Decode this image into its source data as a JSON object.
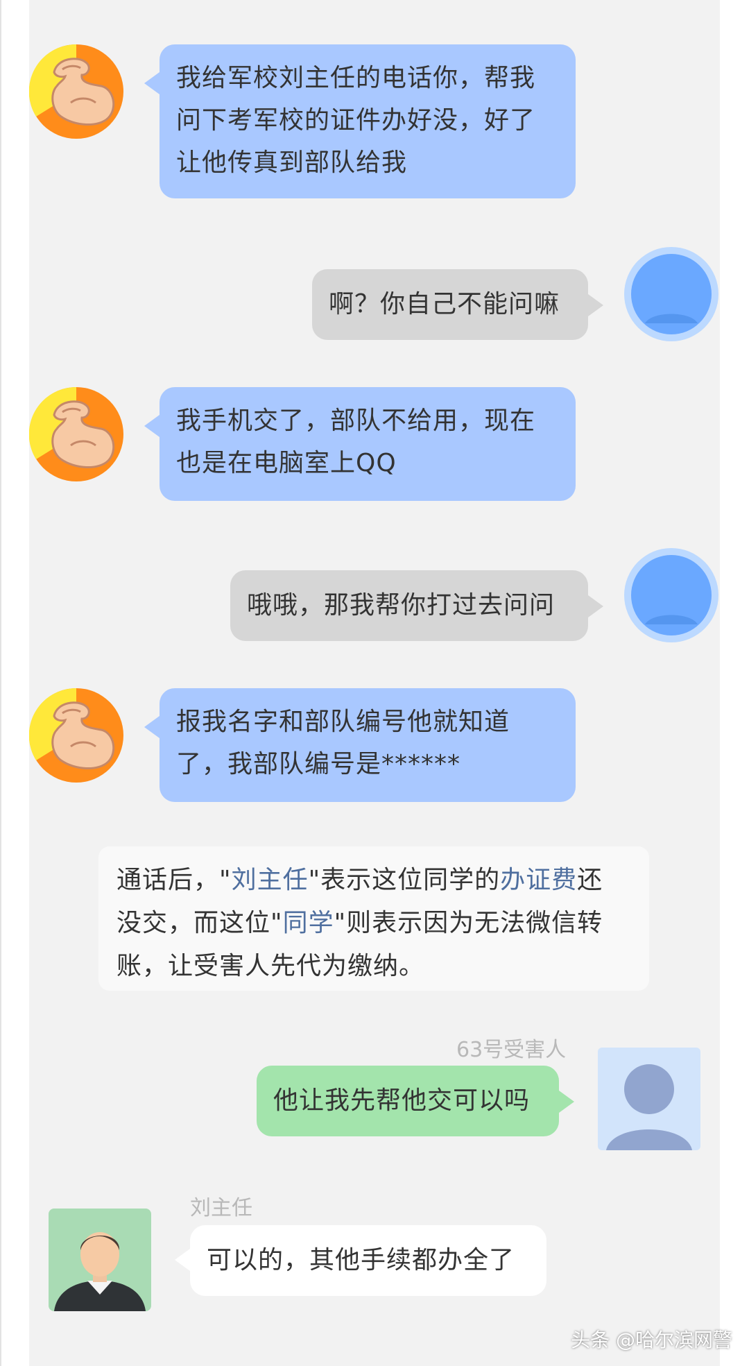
{
  "messages": {
    "m1": {
      "line1": "我给军校刘主任的电话你，帮我",
      "line2": "问下考军校的证件办好没，好了",
      "line3": "让他传真到部队给我"
    },
    "m2": {
      "text": "啊？你自己不能问嘛"
    },
    "m3": {
      "line1": "我手机交了，部队不给用，现在",
      "line2": "也是在电脑室上QQ"
    },
    "m4": {
      "text": "哦哦，那我帮你打过去问问"
    },
    "m5": {
      "line1": "报我名字和部队编号他就知道",
      "line2": "了，我部队编号是******"
    },
    "note": {
      "p1": "通话后，\"",
      "hl1": "刘主任",
      "p2": "\"表示这位同学的",
      "hl2": "办证费",
      "p3": "还",
      "p4": "没交，而这位\"",
      "hl3": "同学",
      "p5": "\"则表示因为无法微信转",
      "p6": "账，让受害人先代为缴纳。"
    },
    "m6": {
      "sender": "63号受害人",
      "text": "他让我先帮他交可以吗"
    },
    "m7": {
      "sender": "刘主任",
      "text": "可以的，其他手续都办全了"
    }
  },
  "watermark": "头条 @哈尔滨网警",
  "colors": {
    "blue_bubble": "#a9c8ff",
    "gray_bubble": "#d6d6d6",
    "green_bubble": "#a3e4ac",
    "note_highlight": "#4f6f9f"
  },
  "icons": [
    "flexing-arm-avatar-icon",
    "default-user-avatar-icon",
    "victim-avatar-icon",
    "man-avatar-icon"
  ]
}
